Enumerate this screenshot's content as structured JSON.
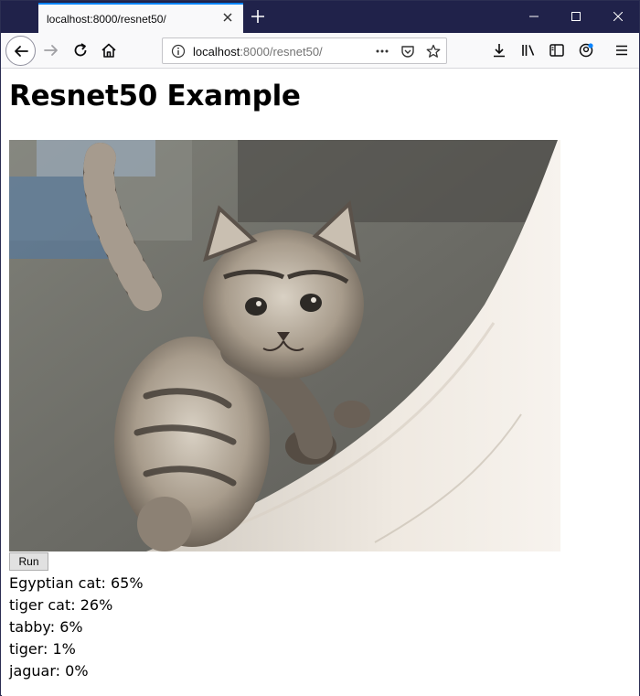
{
  "browser": {
    "tab_title": "localhost:8000/resnet50/",
    "url_host": "localhost",
    "url_rest": ":8000/resnet50/",
    "accent": "#0a84ff",
    "titlebar_color": "#20224a"
  },
  "page": {
    "heading": "Resnet50 Example",
    "run_label": "Run",
    "results": [
      {
        "label": "Egyptian cat",
        "percent": "65%"
      },
      {
        "label": "tiger cat",
        "percent": "26%"
      },
      {
        "label": "tabby",
        "percent": "6%"
      },
      {
        "label": "tiger",
        "percent": "1%"
      },
      {
        "label": "jaguar",
        "percent": "0%"
      }
    ]
  },
  "icons": [
    "back-arrow-icon",
    "forward-arrow-icon",
    "reload-icon",
    "home-icon",
    "info-icon",
    "more-actions-icon",
    "pocket-icon",
    "bookmark-star-icon",
    "download-icon",
    "library-icon",
    "sidebar-icon",
    "account-icon",
    "menu-icon",
    "close-icon",
    "new-tab-icon",
    "minimize-icon",
    "maximize-icon"
  ]
}
